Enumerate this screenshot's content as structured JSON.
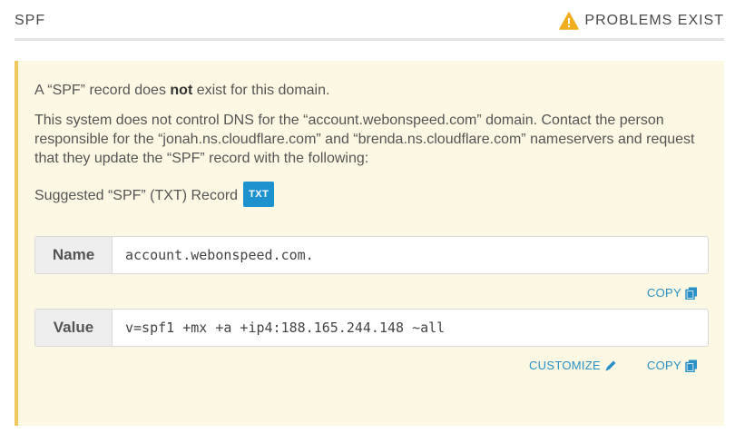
{
  "header": {
    "title": "SPF",
    "status_icon": "warning-triangle-icon",
    "status": "PROBLEMS EXIST",
    "status_color": "#f0ad1e"
  },
  "panel": {
    "bg_color": "#fcf8e3",
    "accent_color": "#f0c95c",
    "message_pre": "A “SPF” record does ",
    "message_bold": "not",
    "message_post": " exist for this domain.",
    "instruction": "This system does not control DNS for the “account.webonspeed.com” domain. Contact the person responsible for the “jonah.ns.cloudflare.com” and “brenda.ns.cloudflare.com” nameservers and request that they update the “SPF” record with the following:",
    "suggested_label": "Suggested “SPF” (TXT) Record",
    "record_type_badge": "TXT",
    "badge_color": "#1e91cf"
  },
  "record": {
    "name_label": "Name",
    "name_value": "account.webonspeed.com.",
    "value_label": "Value",
    "value_value": "v=spf1 +mx +a +ip4:188.165.244.148 ~all"
  },
  "actions": {
    "copy_label": "COPY",
    "customize_label": "CUSTOMIZE",
    "copy_icon": "copy-icon",
    "customize_icon": "pencil-icon",
    "link_color": "#2a8fc4"
  }
}
